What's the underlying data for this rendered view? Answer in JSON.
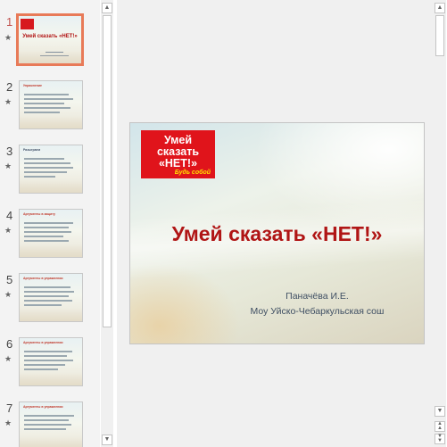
{
  "thumbnails": [
    {
      "num": "1",
      "title": "Умей сказать «НЕТ!»",
      "selected": true
    },
    {
      "num": "2",
      "title": "Упражнение"
    },
    {
      "num": "3",
      "title": "Разыграем"
    },
    {
      "num": "4",
      "title": "Аргументы в защиту"
    },
    {
      "num": "5",
      "title": "Аргументы в упражнении"
    },
    {
      "num": "6",
      "title": "Аргументы в упражнении"
    },
    {
      "num": "7",
      "title": "Аргументы в упражнении"
    }
  ],
  "slide": {
    "logo_lines": [
      "Умей",
      "сказать",
      "«НЕТ!»"
    ],
    "logo_tagline": "Будь собой",
    "title": "Умей сказать «НЕТ!»",
    "author": "Паначёва И.Е.",
    "school": "Моу Уйско-Чебаркульская сош"
  },
  "thumb_slide1": {
    "head": "Умей сказать «НЕТ!»"
  },
  "icons": {
    "star": "star-icon",
    "scroll_up": "chevron-up-icon",
    "scroll_down": "chevron-down-icon"
  },
  "colors": {
    "selection": "#e87a58",
    "title_red": "#b01515",
    "logo_red": "#e0141b"
  }
}
